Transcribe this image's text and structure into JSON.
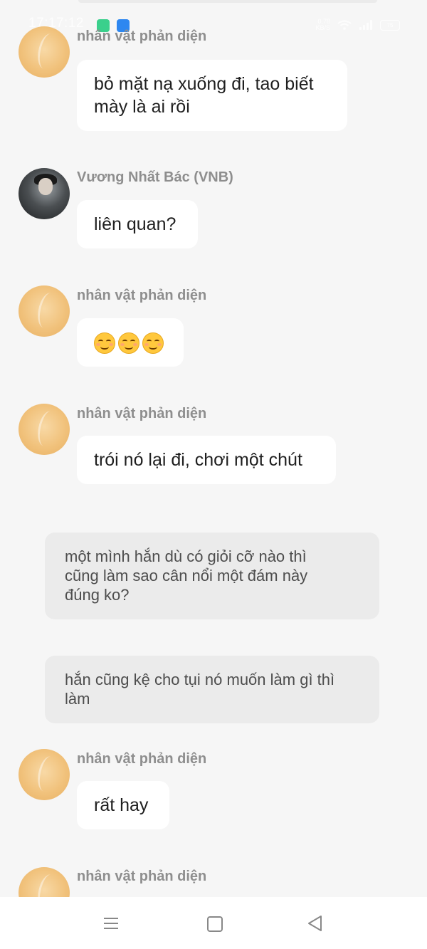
{
  "status_bar": {
    "time": "17:17:12",
    "network_speed_value": "0,78",
    "network_speed_unit": "KB/S",
    "battery": "75"
  },
  "messages": [
    {
      "type": "bubble",
      "sender": "nhân vật phản diện",
      "avatar": "gold-avatar",
      "text_lines": [
        "bỏ mặt nạ xuống đi, tao biết",
        "mày là ai rồi"
      ]
    },
    {
      "type": "bubble",
      "sender": "Vương Nhất Bác (VNB)",
      "avatar": "dark-avatar",
      "text": "liên quan?"
    },
    {
      "type": "emoji",
      "sender": "nhân vật phản diện",
      "avatar": "gold-avatar",
      "emoji": [
        "smiling-face-emoji",
        "smiling-face-emoji",
        "smiling-face-emoji"
      ]
    },
    {
      "type": "bubble",
      "sender": "nhân vật phản diện",
      "avatar": "gold-avatar",
      "text": "trói nó lại đi, chơi một chút"
    },
    {
      "type": "narration",
      "text_lines": [
        "một mình hắn dù có giỏi cỡ nào thì",
        "cũng làm sao cân nổi một đám này",
        "đúng ko?"
      ]
    },
    {
      "type": "narration",
      "text_lines": [
        "hắn cũng kệ cho tụi nó muốn làm gì thì",
        "làm"
      ]
    },
    {
      "type": "bubble",
      "sender": "nhân vật phản diện",
      "avatar": "gold-avatar",
      "text": "rất hay"
    },
    {
      "type": "partial",
      "sender": "nhân vật phản diện",
      "avatar": "gold-avatar"
    }
  ],
  "nav_bar": {
    "icons": [
      "menu-icon",
      "home-icon",
      "back-icon"
    ]
  },
  "colors": {
    "background": "#f6f6f6",
    "bubble": "#ffffff",
    "narration": "#ebebeb",
    "sender": "#8e8e8e"
  }
}
